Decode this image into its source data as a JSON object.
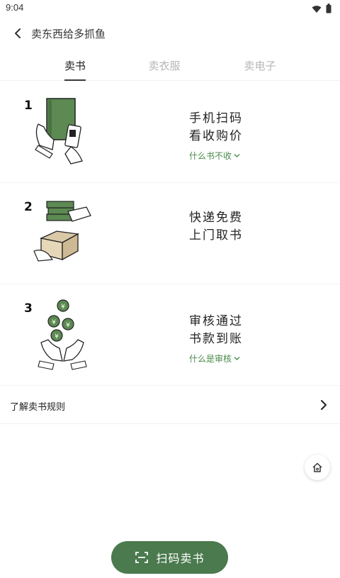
{
  "status": {
    "time": "9:04"
  },
  "nav": {
    "title": "卖东西给多抓鱼"
  },
  "tabs": [
    {
      "label": "卖书",
      "active": true
    },
    {
      "label": "卖衣服",
      "active": false
    },
    {
      "label": "卖电子",
      "active": false
    }
  ],
  "steps": [
    {
      "number": "1",
      "lines": [
        "手机扫码",
        "看收购价"
      ],
      "link": "什么书不收"
    },
    {
      "number": "2",
      "lines": [
        "快递免费",
        "上门取书"
      ],
      "link": ""
    },
    {
      "number": "3",
      "lines": [
        "审核通过",
        "书款到账"
      ],
      "link": "什么是审核"
    }
  ],
  "rules": {
    "label": "了解卖书规则"
  },
  "scan_button": {
    "label": "扫码卖书"
  },
  "colors": {
    "accent": "#4a7a4d",
    "link": "#4a8a4a",
    "book_green": "#5c8a52"
  }
}
